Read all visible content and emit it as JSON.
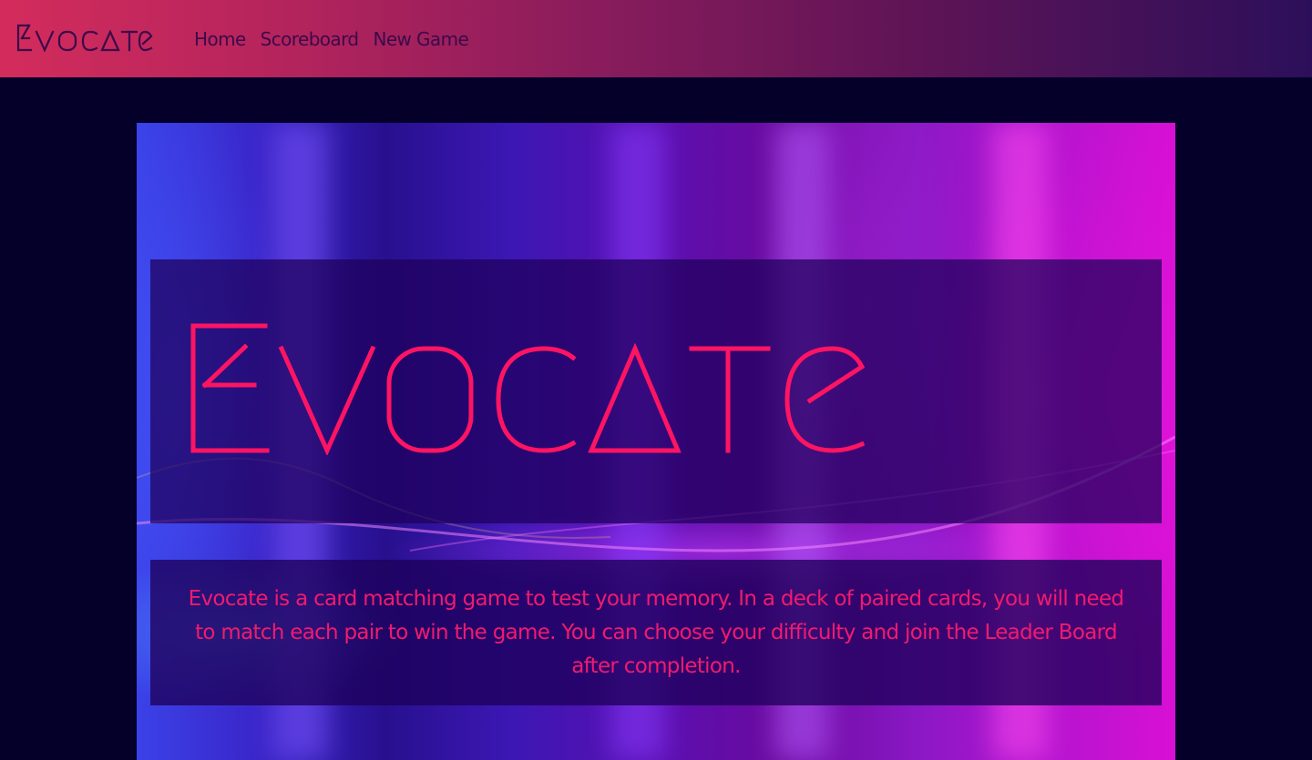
{
  "brand": {
    "name": "Evocate",
    "color": "#3b0a4a"
  },
  "nav": {
    "links": [
      {
        "label": "Home"
      },
      {
        "label": "Scoreboard"
      },
      {
        "label": "New Game"
      }
    ]
  },
  "hero": {
    "title": "Evocate",
    "title_color": "#ff1463",
    "description": "Evocate is a card matching game to test your memory. In a deck of paired cards, you will need to match each pair to win the game. You can choose your difficulty and join the Leader Board after completion."
  },
  "colors": {
    "page_background": "#04002a",
    "accent": "#f21a6e",
    "navbar_start": "#d32c5c",
    "navbar_end": "#2c0f5a"
  }
}
